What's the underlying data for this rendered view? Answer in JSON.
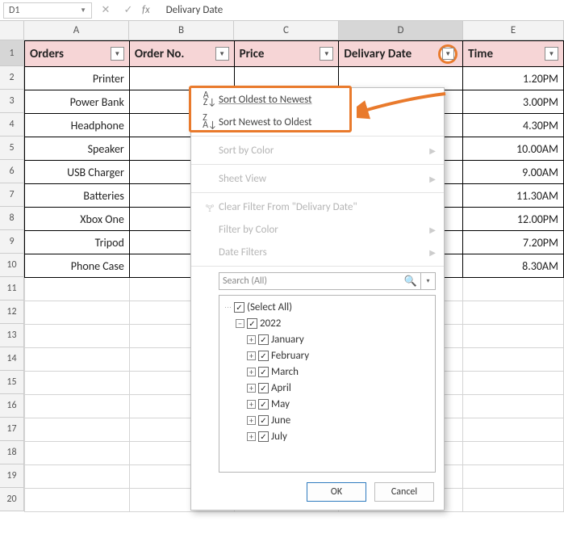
{
  "namebox": {
    "ref": "D1"
  },
  "formula": {
    "text": "Delivary Date"
  },
  "columns": [
    "A",
    "B",
    "C",
    "D",
    "E"
  ],
  "rows": [
    "1",
    "2",
    "3",
    "4",
    "5",
    "6",
    "7",
    "8",
    "9",
    "10",
    "11",
    "12",
    "13",
    "14",
    "15",
    "16",
    "17",
    "18",
    "19",
    "20"
  ],
  "header": {
    "orders": "Orders",
    "order_no": "Order No.",
    "price": "Price",
    "delivery_date": "Delivary Date",
    "time": "Time"
  },
  "data": {
    "orders": [
      "Printer",
      "Power Bank",
      "Headphone",
      "Speaker",
      "USB Charger",
      "Batteries",
      "Xbox One",
      "Tripod",
      "Phone Case"
    ],
    "time": [
      "1.20PM",
      "3.00PM",
      "4.30PM",
      "10.00AM",
      "9.00AM",
      "11.30AM",
      "12.00PM",
      "7.20PM",
      "8.30AM"
    ]
  },
  "menu": {
    "sort_oldest": "Sort Oldest to Newest",
    "sort_newest": "Sort Newest to Oldest",
    "sort_color": "Sort by Color",
    "sheet_view": "Sheet View",
    "clear_filter": "Clear Filter From \"Delivary Date\"",
    "filter_color": "Filter by Color",
    "date_filters": "Date Filters",
    "search_placeholder": "Search (All)",
    "select_all": "(Select All)",
    "year": "2022",
    "months": [
      "January",
      "February",
      "March",
      "April",
      "May",
      "June",
      "July"
    ],
    "ok": "OK",
    "cancel": "Cancel"
  }
}
